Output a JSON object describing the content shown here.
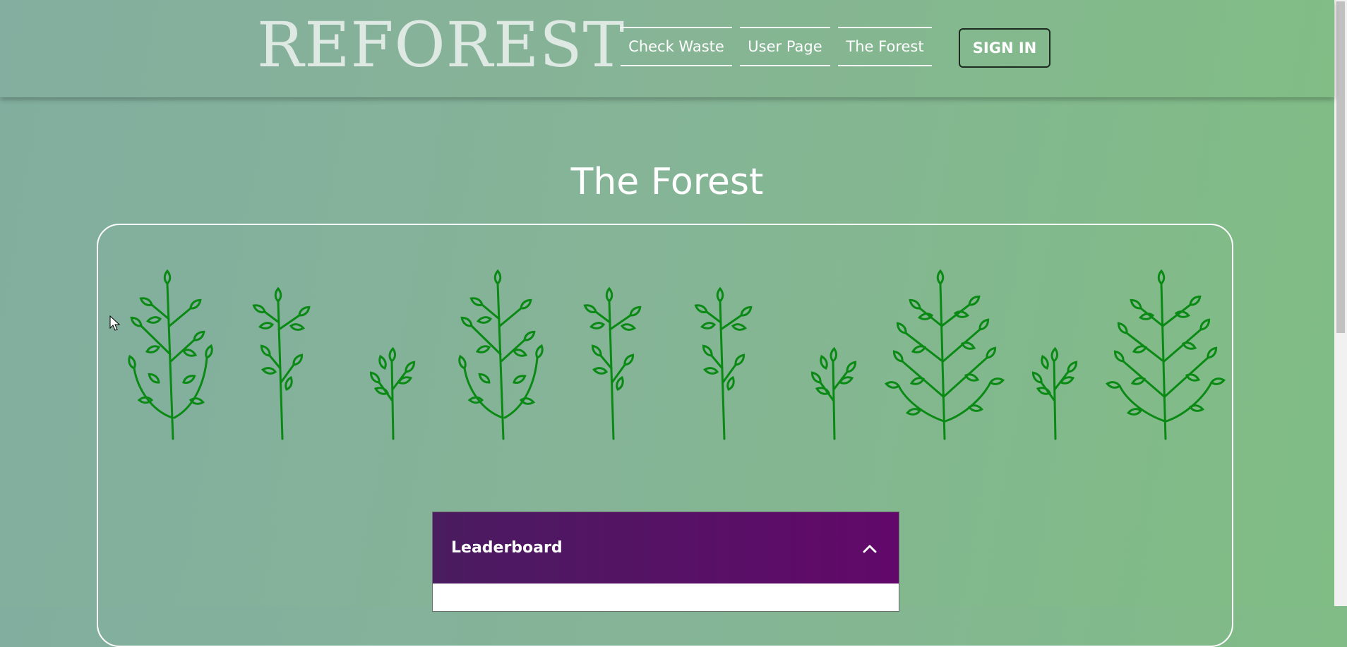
{
  "header": {
    "logo": "REFOREST",
    "nav": [
      "Check Waste",
      "User Page",
      "The Forest"
    ],
    "signin_label": "SIGN IN"
  },
  "main": {
    "title": "The Forest",
    "trees": [
      "bush",
      "sprout",
      "seedling",
      "bush",
      "sprout",
      "sprout",
      "seedling",
      "full-tree",
      "seedling",
      "full-tree"
    ],
    "tree_color": "#0a8a14"
  },
  "leaderboard": {
    "title": "Leaderboard",
    "toggle_icon": "chevron-up-icon"
  },
  "colors": {
    "accent_purple": "#5b0f68",
    "text_light": "#ffffff"
  }
}
